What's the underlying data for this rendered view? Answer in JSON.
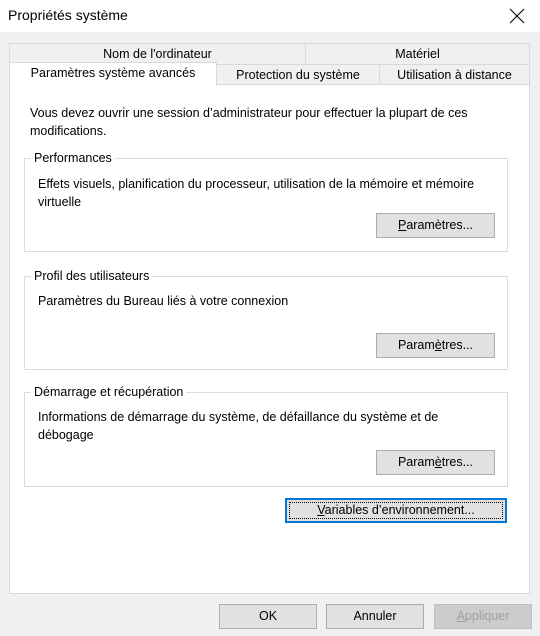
{
  "window": {
    "title": "Propriétés système"
  },
  "tabs": {
    "row1": [
      {
        "label": "Nom de l'ordinateur"
      },
      {
        "label": "Matériel"
      }
    ],
    "row2": [
      {
        "label": "Paramètres système avancés",
        "active": true
      },
      {
        "label": "Protection du système"
      },
      {
        "label": "Utilisation à distance"
      }
    ]
  },
  "panel": {
    "intro": "Vous devez ouvrir une session d’administrateur pour effectuer la plupart de ces modifications.",
    "performance": {
      "title": "Performances",
      "description": "Effets visuels, planification du processeur, utilisation de la mémoire et mémoire virtuelle",
      "button": {
        "before": "",
        "mnemonic": "P",
        "after": "aramètres..."
      }
    },
    "profiles": {
      "title": "Profil des utilisateurs",
      "description": "Paramètres du Bureau liés à votre connexion",
      "button": {
        "before": "Param",
        "mnemonic": "è",
        "after": "tres..."
      }
    },
    "startup": {
      "title": "Démarrage et récupération",
      "description": "Informations de démarrage du système, de défaillance du système et de débogage",
      "button": {
        "before": "Param",
        "mnemonic": "è",
        "after": "tres..."
      }
    },
    "env_button": {
      "before": "",
      "mnemonic": "V",
      "after": "ariables d’environnement..."
    }
  },
  "footer": {
    "ok": "OK",
    "cancel": "Annuler",
    "apply": {
      "before": "",
      "mnemonic": "A",
      "after": "ppliquer",
      "disabled": true
    }
  }
}
